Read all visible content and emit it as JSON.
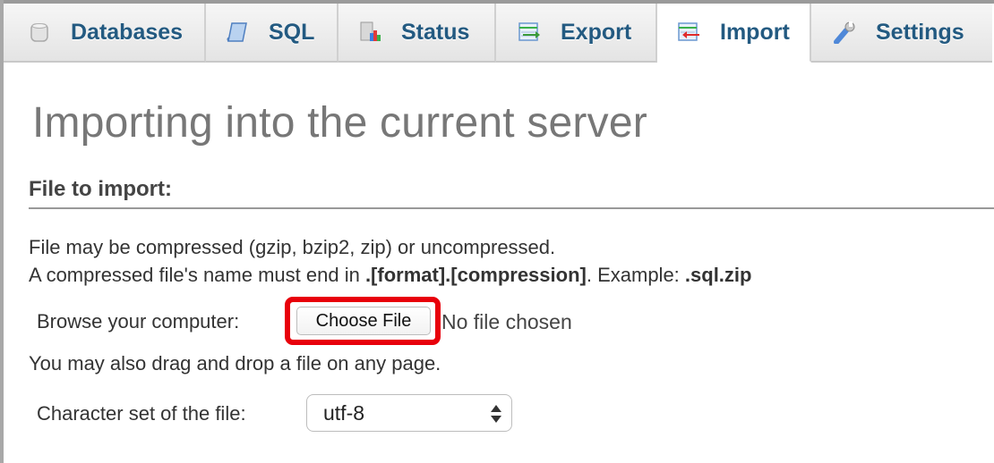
{
  "tabs": [
    {
      "label": "Databases",
      "icon": "database-icon",
      "active": false
    },
    {
      "label": "SQL",
      "icon": "sql-scroll-icon",
      "active": false
    },
    {
      "label": "Status",
      "icon": "status-chart-icon",
      "active": false
    },
    {
      "label": "Export",
      "icon": "export-icon",
      "active": false
    },
    {
      "label": "Import",
      "icon": "import-icon",
      "active": true
    },
    {
      "label": "Settings",
      "icon": "wrench-icon",
      "active": false
    }
  ],
  "page": {
    "title": "Importing into the current server"
  },
  "file_section": {
    "legend": "File to import:",
    "line1": "File may be compressed (gzip, bzip2, zip) or uncompressed.",
    "line2_prefix": "A compressed file's name must end in ",
    "line2_bold": ".[format].[compression]",
    "line2_mid": ". Example: ",
    "line2_example": ".sql.zip",
    "browse_label": "Browse your computer:",
    "choose_button": "Choose File",
    "file_status": "No file chosen",
    "drag_hint": "You may also drag and drop a file on any page.",
    "charset_label": "Character set of the file:",
    "charset_value": "utf-8"
  },
  "colors": {
    "tab_text": "#235a81",
    "highlight": "#e8000b",
    "title": "#777777"
  }
}
